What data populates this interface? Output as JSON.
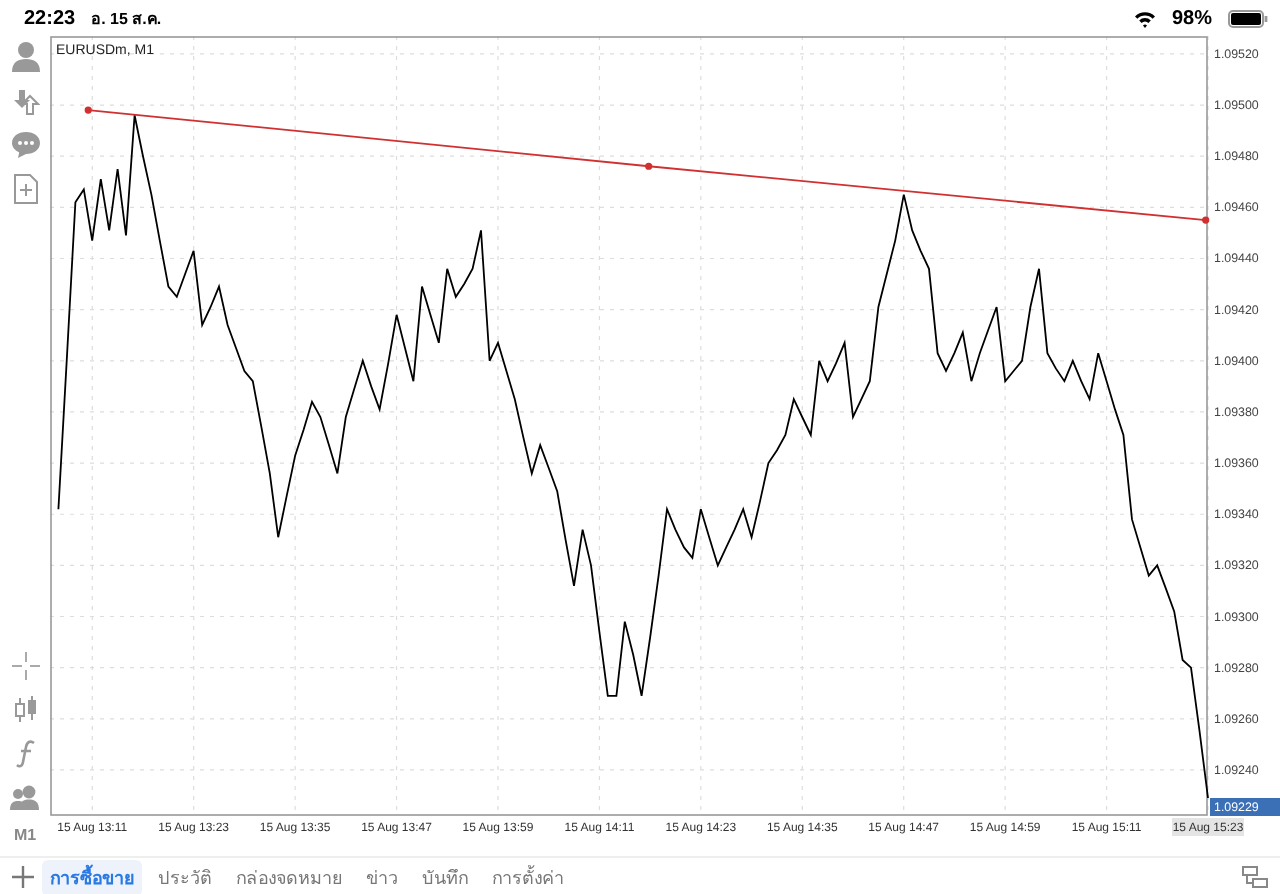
{
  "status_bar": {
    "time": "22:23",
    "date": "อ. 15 ส.ค.",
    "battery": "98%"
  },
  "toolbar": {
    "timeframe": "M1"
  },
  "chart": {
    "title": "EURUSDm, M1",
    "current_price": "1.09229",
    "chart_data": {
      "type": "line",
      "ylim": [
        1.09222,
        1.09527
      ],
      "categories": [
        null,
        null,
        null,
        null,
        "15 Aug 13:11",
        null,
        null,
        null,
        null,
        null,
        null,
        null,
        null,
        null,
        null,
        null,
        "15 Aug 13:23",
        null,
        null,
        null,
        null,
        null,
        null,
        null,
        null,
        null,
        null,
        null,
        "15 Aug 13:35",
        null,
        null,
        null,
        null,
        null,
        null,
        null,
        null,
        null,
        null,
        null,
        "15 Aug 13:47",
        null,
        null,
        null,
        null,
        null,
        null,
        null,
        null,
        null,
        null,
        null,
        "15 Aug 13:59",
        null,
        null,
        null,
        null,
        null,
        null,
        null,
        null,
        null,
        null,
        null,
        "15 Aug 14:11",
        null,
        null,
        null,
        null,
        null,
        null,
        null,
        null,
        null,
        null,
        null,
        "15 Aug 14:23",
        null,
        null,
        null,
        null,
        null,
        null,
        null,
        null,
        null,
        null,
        null,
        "15 Aug 14:35",
        null,
        null,
        null,
        null,
        null,
        null,
        null,
        null,
        null,
        null,
        null,
        "15 Aug 14:47",
        null,
        null,
        null,
        null,
        null,
        null,
        null,
        null,
        null,
        null,
        null,
        "15 Aug 14:59",
        null,
        null,
        null,
        null,
        null,
        null,
        null,
        null,
        null,
        null,
        null,
        "15 Aug 15:11",
        null,
        null,
        null,
        null,
        null,
        null,
        null,
        null,
        null,
        null,
        null,
        "15 Aug 15:23"
      ],
      "yticks": [
        {
          "value": 1.0924,
          "label": "1.09240"
        },
        {
          "value": 1.0926,
          "label": "1.09260"
        },
        {
          "value": 1.0928,
          "label": "1.09280"
        },
        {
          "value": 1.093,
          "label": "1.09300"
        },
        {
          "value": 1.0932,
          "label": "1.09320"
        },
        {
          "value": 1.0934,
          "label": "1.09340"
        },
        {
          "value": 1.0936,
          "label": "1.09360"
        },
        {
          "value": 1.0938,
          "label": "1.09380"
        },
        {
          "value": 1.094,
          "label": "1.09400"
        },
        {
          "value": 1.0942,
          "label": "1.09420"
        },
        {
          "value": 1.0944,
          "label": "1.09440"
        },
        {
          "value": 1.0946,
          "label": "1.09460"
        },
        {
          "value": 1.0948,
          "label": "1.09480"
        },
        {
          "value": 1.095,
          "label": "1.09500"
        },
        {
          "value": 1.0952,
          "label": "1.09520"
        }
      ],
      "grid": true,
      "series": [
        {
          "color": "#000000",
          "values": [
            1.09342,
            1.09402,
            1.09462,
            1.09467,
            1.09447,
            1.09471,
            1.09451,
            1.09475,
            1.09449,
            1.09496,
            1.0948,
            1.09465,
            1.09447,
            1.09429,
            1.09425,
            1.09434,
            1.09443,
            1.09414,
            1.09421,
            1.09429,
            1.09414,
            1.09405,
            1.09396,
            1.09392,
            1.09374,
            1.09356,
            1.09331,
            1.09347,
            1.09363,
            1.09373,
            1.09384,
            1.09378,
            1.09367,
            1.09356,
            1.09378,
            1.09389,
            1.094,
            1.0939,
            1.09381,
            1.09399,
            1.09418,
            1.09405,
            1.09392,
            1.09429,
            1.09418,
            1.09407,
            1.09436,
            1.09425,
            1.0943,
            1.09436,
            1.09451,
            1.094,
            1.09407,
            1.09396,
            1.09385,
            1.0937,
            1.09356,
            1.09367,
            1.09358,
            1.09349,
            1.0933,
            1.09312,
            1.09334,
            1.0932,
            1.09294,
            1.09269,
            1.09269,
            1.09298,
            1.09285,
            1.09269,
            1.09292,
            1.09316,
            1.09342,
            1.09334,
            1.09327,
            1.09323,
            1.09342,
            1.09331,
            1.0932,
            1.09327,
            1.09334,
            1.09342,
            1.09331,
            1.09345,
            1.0936,
            1.09365,
            1.09371,
            1.09385,
            1.09378,
            1.09371,
            1.094,
            1.09392,
            1.09399,
            1.09407,
            1.09378,
            1.09385,
            1.09392,
            1.09421,
            1.09434,
            1.09447,
            1.09465,
            1.09451,
            1.09443,
            1.09436,
            1.09403,
            1.09396,
            1.09403,
            1.09411,
            1.09392,
            1.09403,
            1.09412,
            1.09421,
            1.09392,
            1.09396,
            1.094,
            1.09421,
            1.09436,
            1.09403,
            1.09397,
            1.09392,
            1.094,
            1.09392,
            1.09385,
            1.09403,
            1.09392,
            1.09381,
            1.09371,
            1.09338,
            1.09327,
            1.09316,
            1.0932,
            1.09311,
            1.09302,
            1.09283,
            1.0928,
            1.09255,
            1.09229
          ]
        }
      ]
    }
  },
  "tabs": [
    {
      "label": "การซื้อขาย",
      "selected": true
    },
    {
      "label": "ประวัติ",
      "selected": false
    },
    {
      "label": "กล่องจดหมาย",
      "selected": false
    },
    {
      "label": "ข่าว",
      "selected": false
    },
    {
      "label": "บันทึก",
      "selected": false
    },
    {
      "label": "การตั้งค่า",
      "selected": false
    }
  ]
}
